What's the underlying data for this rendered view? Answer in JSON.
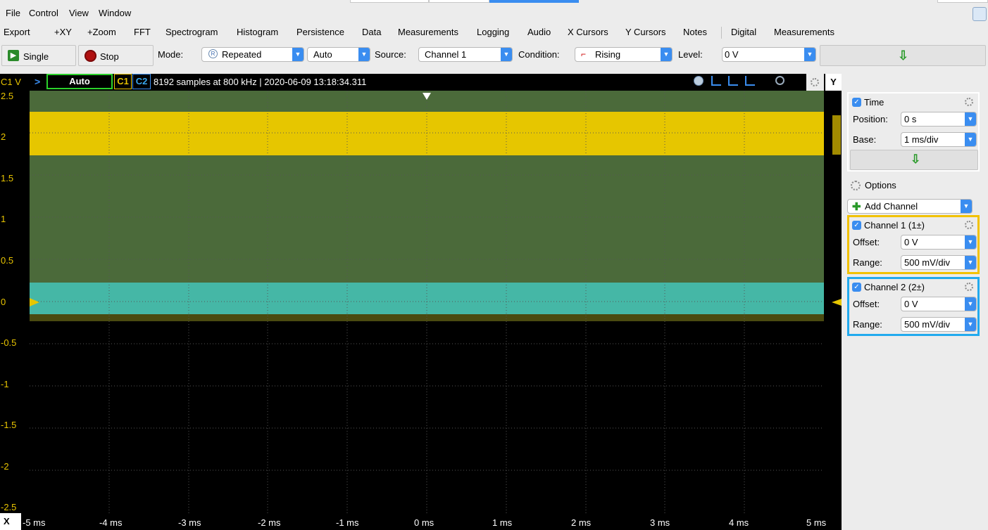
{
  "menubar": {
    "items": [
      "File",
      "Control",
      "View",
      "Window"
    ]
  },
  "toolbar1": {
    "items": [
      "Export",
      "+XY",
      "+Zoom",
      "FFT",
      "Spectrogram",
      "Histogram",
      "Persistence",
      "Data",
      "Measurements",
      "Logging",
      "Audio",
      "X Cursors",
      "Y Cursors",
      "Notes",
      "Digital",
      "Measurements"
    ]
  },
  "toolbar2": {
    "single_label": "Single",
    "stop_label": "Stop",
    "mode_label": "Mode:",
    "mode_value": "Repeated",
    "auto_value": "Auto",
    "source_label": "Source:",
    "source_value": "Channel 1",
    "condition_label": "Condition:",
    "condition_value": "Rising",
    "level_label": "Level:",
    "level_value": "0 V",
    "apply_symbol": "⇩"
  },
  "scope_header": {
    "ch_scale_label": "C1 V",
    "run_state": "Auto",
    "c1_label": "C1",
    "c2_label": "C2",
    "info": "8192 samples at 800 kHz | 2020-06-09 13:18:34.311",
    "y_button": "Y",
    "arrow_symbol": "⇨"
  },
  "y_axis": {
    "ticks": [
      "2.5",
      "2",
      "1.5",
      "1",
      "0.5",
      "0",
      "-0.5",
      "-1",
      "-1.5",
      "-2",
      "-2.5"
    ]
  },
  "x_axis": {
    "corner_label": "X",
    "ticks": [
      "-5 ms",
      "-4 ms",
      "-3 ms",
      "-2 ms",
      "-1 ms",
      "0 ms",
      "1 ms",
      "2 ms",
      "3 ms",
      "4 ms",
      "5 ms"
    ]
  },
  "time_panel": {
    "title": "Time",
    "position_label": "Position:",
    "position_value": "0 s",
    "base_label": "Base:",
    "base_value": "1 ms/div",
    "apply_symbol": "⇩"
  },
  "options_label": "Options",
  "add_channel_label": "Add Channel",
  "channel1": {
    "title": "Channel 1 (1±)",
    "offset_label": "Offset:",
    "offset_value": "0 V",
    "range_label": "Range:",
    "range_value": "500 mV/div"
  },
  "channel2": {
    "title": "Channel 2 (2±)",
    "offset_label": "Offset:",
    "offset_value": "0 V",
    "range_label": "Range:",
    "range_value": "500 mV/div"
  },
  "colors": {
    "ch1": "#e6c600",
    "ch2": "#45b7a6",
    "plot_bg": "#000000",
    "grid_fill": "#4a6a3a",
    "accent": "#3a8df0"
  }
}
